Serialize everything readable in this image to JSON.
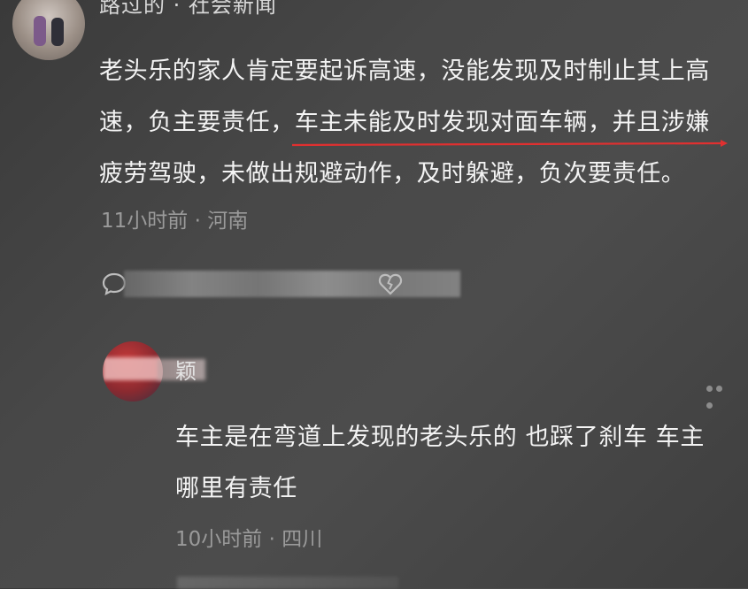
{
  "top_comment": {
    "username": "路过的 · 社会新闻",
    "text_before": "老头乐的家人肯定要起诉高速，没能发现及时制止其上高速，负主要责任，",
    "text_underlined": "车主未能及时发现对面车辆，并且涉嫌",
    "text_after": "疲劳驾驶，未做出规避动作，及时躲避，负次要责任。",
    "time": "11小时前",
    "separator": " · ",
    "location": "河南",
    "underline_color": "#e03030"
  },
  "reply": {
    "username": "颖",
    "text": "车主是在弯道上发现的老头乐的 也踩了刹车 车主哪里有责任",
    "time": "10小时前",
    "separator": " · ",
    "location": "四川"
  },
  "icons": {
    "reply": "comment-bubble-icon",
    "like": "broken-heart-icon",
    "more": "more-dots-icon"
  }
}
